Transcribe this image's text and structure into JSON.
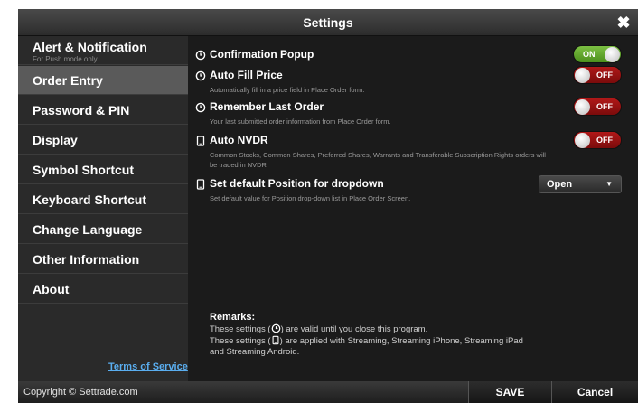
{
  "window": {
    "title": "Settings",
    "close_symbol": "✖"
  },
  "sidebar": {
    "items": [
      {
        "label": "Alert & Notification",
        "sub": "For Push mode only"
      },
      {
        "label": "Order Entry"
      },
      {
        "label": "Password & PIN"
      },
      {
        "label": "Display"
      },
      {
        "label": "Symbol Shortcut"
      },
      {
        "label": "Keyboard Shortcut"
      },
      {
        "label": "Change Language"
      },
      {
        "label": "Other Information"
      },
      {
        "label": "About"
      }
    ],
    "active_item": "Order Entry",
    "terms_link": "Terms of Service"
  },
  "settings": [
    {
      "icon": "clock-icon",
      "label": "Confirmation Popup",
      "desc": "",
      "state": "ON"
    },
    {
      "icon": "clock-icon",
      "label": "Auto Fill Price",
      "desc": "Automatically fill in a price field in Place Order form.",
      "state": "OFF"
    },
    {
      "icon": "clock-icon",
      "label": "Remember Last Order",
      "desc": "Your last submitted order information from Place Order form.",
      "state": "OFF"
    },
    {
      "icon": "device-icon",
      "label": "Auto NVDR",
      "desc": "Common Stocks, Common Shares, Preferred Shares, Warrants and Transferable Subscription Rights orders will be traded in NVDR",
      "state": "OFF"
    },
    {
      "icon": "device-icon",
      "label": "Set default Position for dropdown",
      "desc": "Set default value for Position drop-down list in Place Order Screen.",
      "select_value": "Open"
    }
  ],
  "remarks": {
    "title": "Remarks:",
    "line1_pre": "These settings (",
    "line1_post": ") are valid until you close this program.",
    "line2_pre": "These settings (",
    "line2_post": ") are applied with Streaming, Streaming iPhone, Streaming iPad",
    "line3": "and Streaming Android."
  },
  "footer": {
    "copyright": "Copyright © Settrade.com",
    "save": "SAVE",
    "cancel": "Cancel"
  },
  "colors": {
    "toggle_on": "#5fa52c",
    "toggle_off": "#9c1515",
    "link": "#5aaef0",
    "panel": "#1b1b1b",
    "sidebar": "#2a2a2a"
  }
}
